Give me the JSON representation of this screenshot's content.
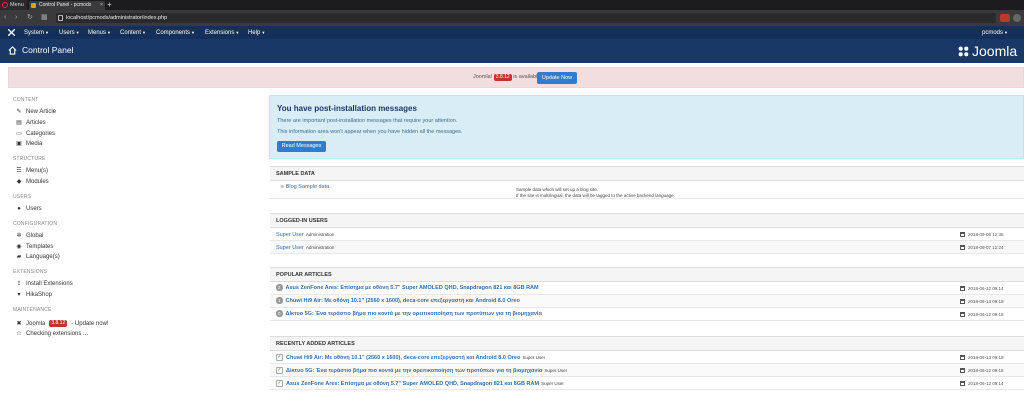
{
  "browser": {
    "menu_label": "Menu",
    "tab_title": "Control Panel - pcmods",
    "new_tab_symbol": "+",
    "url": "localhost/pcmods/administrator/index.php"
  },
  "topnav": {
    "items": [
      "System",
      "Users",
      "Menus",
      "Content",
      "Components",
      "Extensions",
      "Help"
    ],
    "user": "pcmods"
  },
  "header": {
    "title": "Control Panel",
    "logo_text": "Joomla"
  },
  "update_banner": {
    "prefix": "Joomla!",
    "version": "3.8.12",
    "suffix": "is available:",
    "button": "Update Now"
  },
  "sidebar": {
    "sections": [
      {
        "heading": "CONTENT",
        "items": [
          {
            "label": "New Article",
            "icon": "pencil-icon"
          },
          {
            "label": "Articles",
            "icon": "stack-icon"
          },
          {
            "label": "Categories",
            "icon": "folder-icon"
          },
          {
            "label": "Media",
            "icon": "image-icon"
          }
        ]
      },
      {
        "heading": "STRUCTURE",
        "items": [
          {
            "label": "Menu(s)",
            "icon": "list-icon"
          },
          {
            "label": "Modules",
            "icon": "cube-icon"
          }
        ]
      },
      {
        "heading": "USERS",
        "items": [
          {
            "label": "Users",
            "icon": "users-icon"
          }
        ]
      },
      {
        "heading": "CONFIGURATION",
        "items": [
          {
            "label": "Global",
            "icon": "gear-icon"
          },
          {
            "label": "Templates",
            "icon": "eye-icon"
          },
          {
            "label": "Language(s)",
            "icon": "comments-icon"
          }
        ]
      },
      {
        "heading": "EXTENSIONS",
        "items": [
          {
            "label": "Install Extensions",
            "icon": "upload-icon"
          },
          {
            "label": "HikaShop",
            "icon": "cart-icon"
          }
        ]
      },
      {
        "heading": "MAINTENANCE",
        "items": [
          {
            "label": "Joomla",
            "icon": "joomla-icon",
            "badge": "3.8.12",
            "extra": "- Update now!"
          },
          {
            "label": "Checking extensions ...",
            "icon": "star-icon"
          }
        ]
      }
    ]
  },
  "postinstall": {
    "title": "You have post-installation messages",
    "line1": "There are important post-installation messages that require your attention.",
    "line2": "This information area won't appear when you have hidden all the messages.",
    "button": "Read Messages"
  },
  "sample_data": {
    "heading": "SAMPLE DATA",
    "item": "Blog Sample data",
    "desc1": "Sample data which will set up a blog site.",
    "desc2": "If the site is multilingual, the data will be tagged to the active backend language."
  },
  "logged_in": {
    "heading": "LOGGED-IN USERS",
    "rows": [
      {
        "name": "Super User",
        "role": "Administration",
        "date": "2018-09-06 12:35"
      },
      {
        "name": "Super User",
        "role": "Administration",
        "date": "2018-09-07 12:24"
      }
    ]
  },
  "popular": {
    "heading": "POPULAR ARTICLES",
    "rows": [
      {
        "hits": "2",
        "title": "Asus ZenFone Ares: Επίσημα με οθόνη 5.7\" Super AMOLED QHD, Snapdragon 821 και 8GB RAM",
        "date": "2018-06-12 09:14"
      },
      {
        "hits": "1",
        "title": "Chuwi Hi9 Air: Με οθόνη 10.1\" (2560 x 1600), deca-core επεξεργαστή και Android 8.0 Oreo",
        "date": "2018-06-13 09:19"
      },
      {
        "hits": "0",
        "title": "Δίκτυο 5G: Ένα τεράστιο βήμα πιο κοντά με την ορειτικοποίηση των προτύπων για τη βιομηχανία",
        "date": "2018-06-12 09:16"
      }
    ]
  },
  "recent": {
    "heading": "RECENTLY ADDED ARTICLES",
    "rows": [
      {
        "title": "Chuwi Hi9 Air: Με οθόνη 10.1\" (2560 x 1600), deca-core επεξεργαστή και Android 8.0 Oreo",
        "author": "Super User",
        "date": "2018-06-13 09:19"
      },
      {
        "title": "Δίκτυο 5G: Ένα τεράστιο βήμα πιο κοντά με την ορειτικοποίηση των προτύπων για τη βιομηχανία",
        "author": "Super User",
        "date": "2018-06-12 09:16"
      },
      {
        "title": "Asus ZenFone Ares: Επίσημα με οθόνη 5.7\" Super AMOLED QHD, Snapdragon 821 και 8GB RAM",
        "author": "Super User",
        "date": "2018-06-12 09:14"
      }
    ]
  },
  "colors": {
    "nav_bg": "#14305a",
    "header_bg": "#1a3867",
    "primary_button": "#2f7dd0",
    "danger_badge": "#bd362f",
    "info_bg": "#d9edf7",
    "alert_bg": "#f2dede"
  }
}
